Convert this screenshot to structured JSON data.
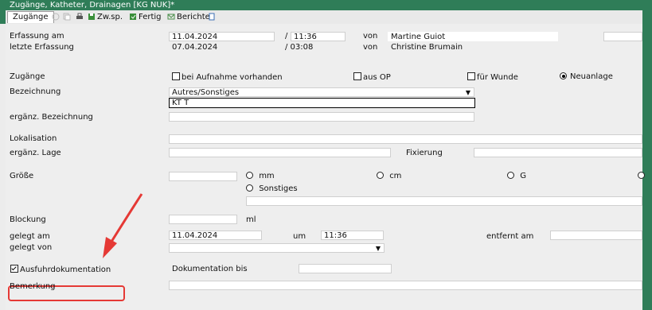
{
  "window": {
    "title": "Zugänge, Katheter, Drainagen [KG NUK]*"
  },
  "toolbar": {
    "tab_label": "Zugänge",
    "zwsp_label": "Zw.sp.",
    "fertig_label": "Fertig",
    "berichte_label": "Berichte"
  },
  "form": {
    "erfassung_am_label": "Erfassung am",
    "erfassung_date": "11.04.2024",
    "erfassung_time_sep": "/",
    "erfassung_time": "11:36",
    "von_label": "von",
    "erfassung_user": "Martine Guiot",
    "letzte_label": "letzte Erfassung",
    "letzte_date": "07.04.2024",
    "letzte_time": "/ 03:08",
    "letzte_von_label": "von",
    "letzte_user": "Christine Brumain",
    "zugaenge_label": "Zugänge",
    "opt_aufnahme": "bei Aufnahme vorhanden",
    "opt_op": "aus OP",
    "opt_wunde": "für Wunde",
    "opt_neuanlage": "Neuanlage",
    "bezeichnung_label": "Bezeichnung",
    "bezeichnung_value": "Autres/Sonstiges",
    "bezeichnung_text": "KT T",
    "erg_bez_label": "ergänz. Bezeichnung",
    "lokalisation_label": "Lokalisation",
    "erg_lage_label": "ergänz. Lage",
    "fixierung_label": "Fixierung",
    "groesse_label": "Größe",
    "unit_mm": "mm",
    "unit_cm": "cm",
    "unit_g": "G",
    "unit_sonstiges": "Sonstiges",
    "blockung_label": "Blockung",
    "blockung_unit": "ml",
    "gelegt_am_label": "gelegt am",
    "gelegt_am_date": "11.04.2024",
    "um_label": "um",
    "gelegt_time": "11:36",
    "entfernt_label": "entfernt am",
    "gelegt_von_label": "gelegt von",
    "ausfuhr_label": "Ausfuhrdokumentation",
    "doku_bis_label": "Dokumentation bis",
    "bemerkung_label": "Bemerkung"
  },
  "colors": {
    "titlebar": "#2f7d58",
    "highlight": "#e53935"
  }
}
